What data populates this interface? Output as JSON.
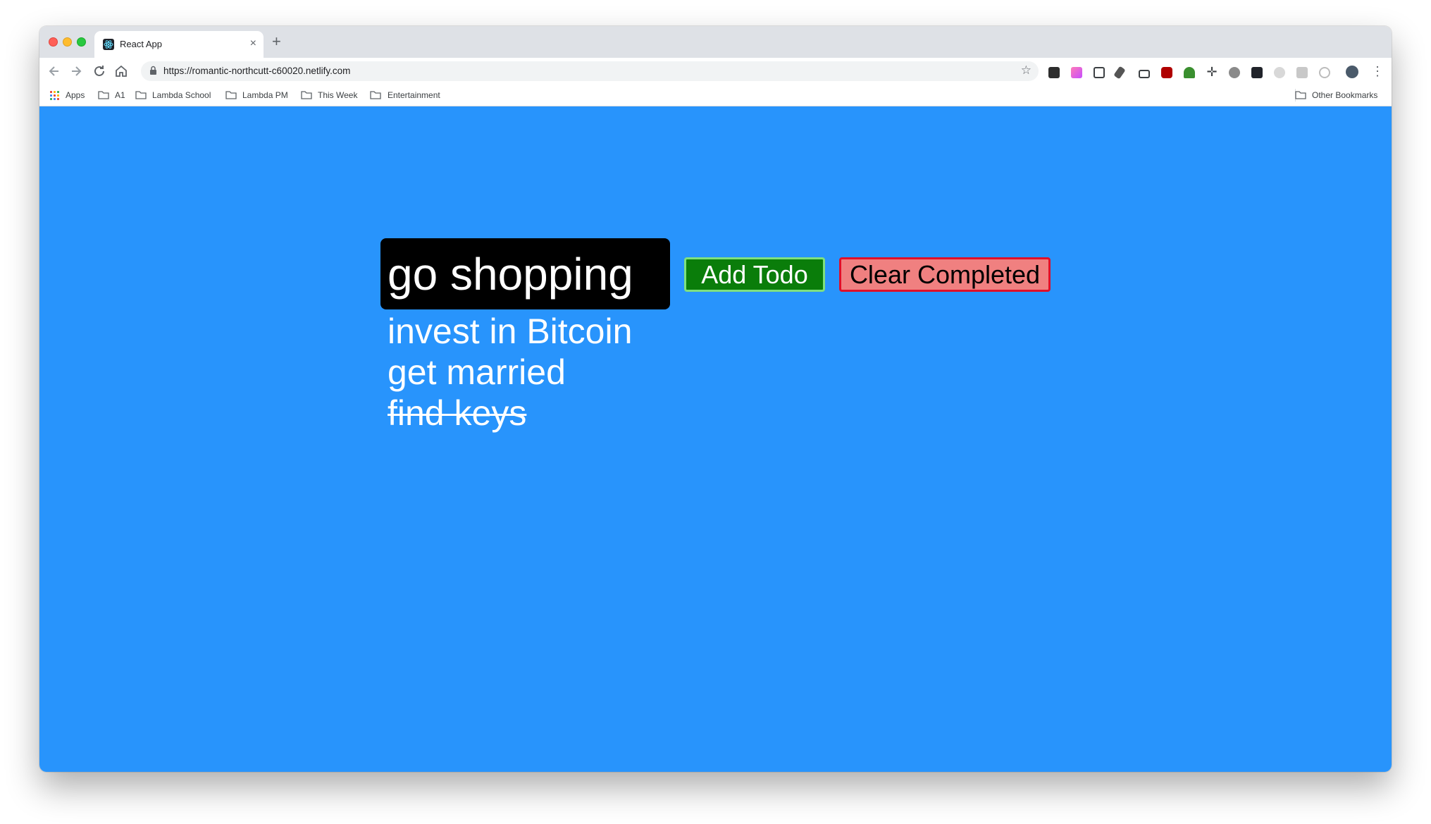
{
  "browser": {
    "tab": {
      "title": "React App",
      "close_glyph": "×"
    },
    "new_tab_glyph": "+",
    "url": "https://romantic-northcutt-c60020.netlify.com",
    "bookmarks": [
      {
        "label": "Apps"
      },
      {
        "label": "A1"
      },
      {
        "label": "Lambda School"
      },
      {
        "label": "Lambda PM"
      },
      {
        "label": "This Week"
      },
      {
        "label": "Entertainment"
      }
    ],
    "other_bookmarks": "Other Bookmarks"
  },
  "app": {
    "input_value": "go shopping",
    "add_button_label": "Add Todo",
    "clear_button_label": "Clear Completed",
    "todos": [
      {
        "text": "invest in Bitcoin",
        "completed": false
      },
      {
        "text": "get married",
        "completed": false
      },
      {
        "text": "find keys",
        "completed": true
      }
    ]
  },
  "colors": {
    "page_background": "#2894fc",
    "add_button": "#0a7d0a",
    "clear_button": "#f08080"
  }
}
